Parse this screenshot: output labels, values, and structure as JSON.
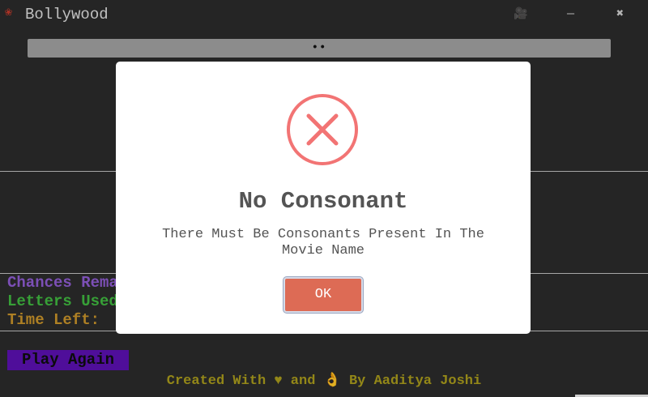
{
  "window": {
    "title": "Bollywood",
    "icon": "film-reel-icon",
    "controls": {
      "camera_glyph": "🎥",
      "minimize_glyph": "—",
      "close_glyph": "✖"
    }
  },
  "progress": {
    "text": "••"
  },
  "stats": {
    "chances_label": "Chances Remaining:",
    "letters_label": "Letters Used:",
    "time_label": "Time Left:"
  },
  "actions": {
    "play_again": "Play Again"
  },
  "footer": {
    "credit": "Created With ♥ and 👌 By Aaditya Joshi"
  },
  "dialog": {
    "icon": "error-x-icon",
    "title": "No Consonant",
    "message": "There Must Be Consonants Present In The Movie Name",
    "ok_label": "OK"
  },
  "colors": {
    "background": "#2b2b2b",
    "chances": "#8e5bd0",
    "letters": "#3fb73f",
    "time": "#c7922a",
    "play_again_bg": "#5a10b0",
    "footer": "#a89a1c",
    "ok_button": "#dd6b55",
    "error_icon": "#f27474"
  }
}
